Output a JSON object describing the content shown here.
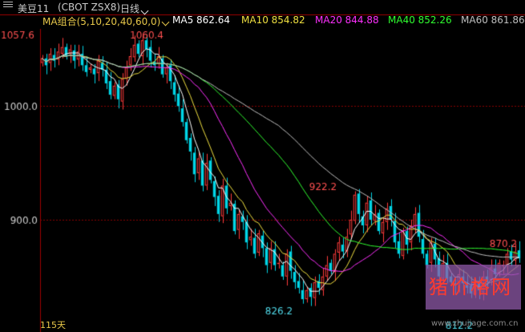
{
  "header": {
    "symbol": "美豆11",
    "code": "(CBOT ZSX8)",
    "kline_type": "日线"
  },
  "ma_legend": {
    "group_label": "MA组合(5,10,20,40,60,0)",
    "ma5": "MA5 862.64",
    "ma10": "MA10 854.82",
    "ma20": "MA20 844.88",
    "ma40": "MA40 852.26",
    "ma60": "MA60 861.86"
  },
  "colors": {
    "bg": "#000000",
    "up": "#ff3b3b",
    "down": "#00d5e6",
    "ma5": "#ffffff",
    "ma10": "#f0e040",
    "ma20": "#ff30ff",
    "ma40": "#30ff30",
    "ma60": "#c0c0c0",
    "grid": "#8b0000",
    "axis_text": "#d0d0d0"
  },
  "period_label": "115天",
  "watermark": {
    "text": "猪价格网",
    "url": "www.zhujiage.com.cn"
  },
  "chart_data": {
    "type": "candlestick",
    "ylim": [
      811,
      1068
    ],
    "y_ticks": [
      1000.0,
      900.0
    ],
    "y_tick_labels": [
      "1000.0",
      "900.0"
    ],
    "annotations": [
      {
        "label": "1057.6",
        "value": 1057.6
      },
      {
        "label": "1060.4",
        "value": 1060.4
      },
      {
        "label": "922.2",
        "value": 922.2
      },
      {
        "label": "826.2",
        "value": 826.2
      },
      {
        "label": "870.2",
        "value": 870.2
      },
      {
        "label": "812.2",
        "value": 812.2
      }
    ],
    "close_prices": [
      1042,
      1036,
      1046,
      1040,
      1048,
      1052,
      1044,
      1050,
      1040,
      1048,
      1036,
      1030,
      1034,
      1028,
      1040,
      1032,
      1020,
      1010,
      1018,
      1006,
      1024,
      1034,
      1044,
      1054,
      1046,
      1058,
      1050,
      1040,
      1036,
      1044,
      1028,
      1034,
      1022,
      1010,
      1000,
      986,
      970,
      960,
      940,
      954,
      930,
      950,
      935,
      920,
      905,
      930,
      910,
      915,
      890,
      905,
      898,
      880,
      885,
      870,
      888,
      875,
      860,
      875,
      860,
      862,
      850,
      870,
      855,
      845,
      840,
      830,
      838,
      832,
      845,
      840,
      850,
      860,
      855,
      870,
      880,
      872,
      885,
      900,
      922,
      905,
      895,
      915,
      900,
      905,
      890,
      898,
      910,
      900,
      880,
      870,
      890,
      878,
      895,
      905,
      885,
      870,
      860,
      880,
      865,
      850,
      862,
      848,
      845,
      842,
      852,
      844,
      840,
      835,
      845,
      838,
      850,
      845,
      858,
      852,
      862,
      860,
      870,
      865,
      872,
      866
    ]
  }
}
